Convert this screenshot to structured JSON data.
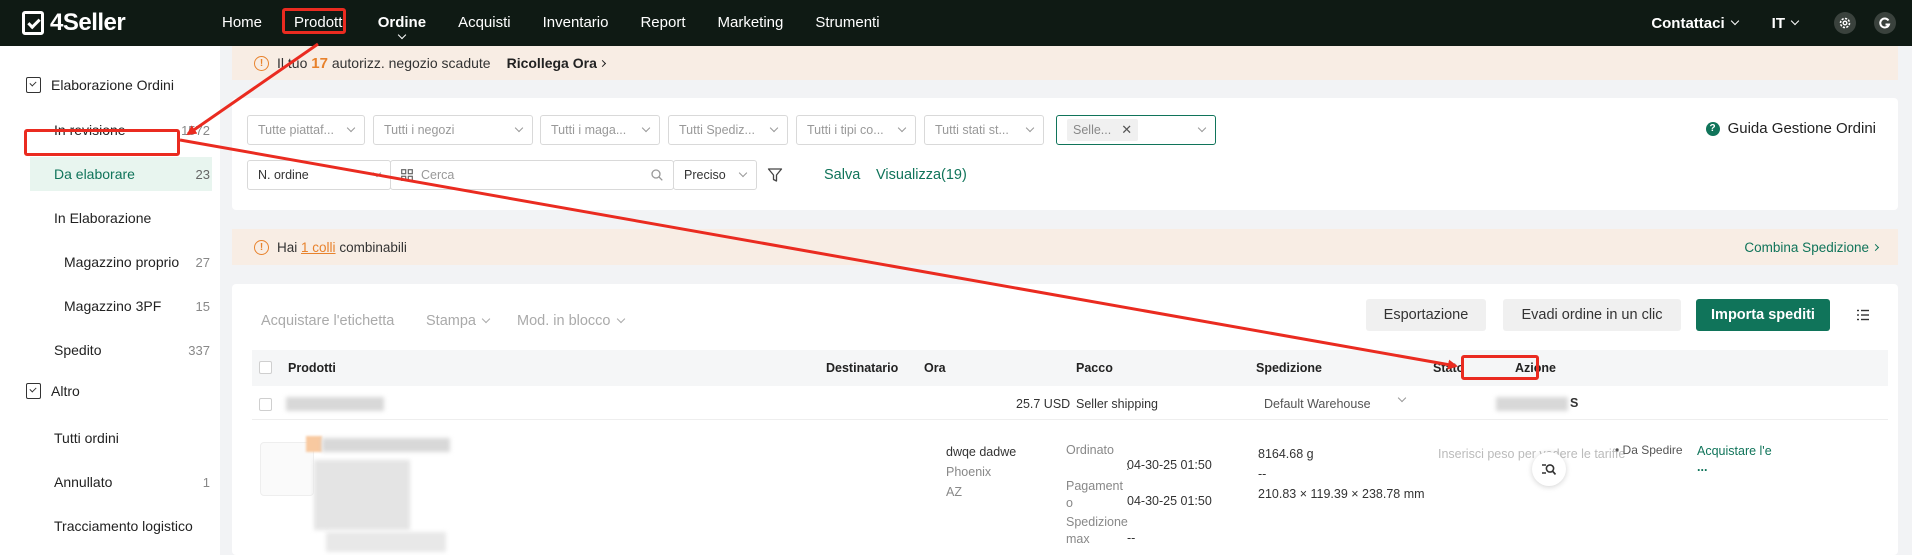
{
  "app": {
    "logo": "4Seller"
  },
  "topnav": {
    "items": [
      "Home",
      "Prodotti",
      "Ordine",
      "Acquisti",
      "Inventario",
      "Report",
      "Marketing",
      "Strumenti"
    ],
    "right": {
      "contact": "Contattaci",
      "language": "IT"
    }
  },
  "sidebar": {
    "group1": "Elaborazione Ordini",
    "items1": [
      {
        "label": "In revisione",
        "count": "1572"
      },
      {
        "label": "Da elaborare",
        "count": "23"
      },
      {
        "label": "In Elaborazione",
        "count": ""
      },
      {
        "label": "Magazzino proprio",
        "count": "27"
      },
      {
        "label": "Magazzino 3PF",
        "count": "15"
      },
      {
        "label": "Spedito",
        "count": "337"
      }
    ],
    "group2": "Altro",
    "items2": [
      {
        "label": "Tutti ordini",
        "count": ""
      },
      {
        "label": "Annullato",
        "count": "1"
      },
      {
        "label": "Tracciamento logistico",
        "count": ""
      }
    ]
  },
  "warning": {
    "prefix": "Il tuo",
    "count": "17",
    "suffix": "autorizz. negozio scadute",
    "link": "Ricollega Ora"
  },
  "filters": {
    "selects": [
      "Tutte piattaf...",
      "Tutti i negozi",
      "Tutti i maga...",
      "Tutti Spediz...",
      "Tutti i tipi co...",
      "Tutti stati st..."
    ],
    "tag": "Selle...",
    "help": "Guida Gestione Ordini",
    "order_field": "N. ordine",
    "search_placeholder": "Cerca",
    "match": "Preciso",
    "save": "Salva",
    "view": "Visualizza(19)"
  },
  "combine": {
    "prefix": "Hai",
    "link": "1 colli",
    "suffix": "combinabili",
    "action": "Combina Spedizione"
  },
  "toolbar": {
    "buy_label": "Acquistare l'etichetta",
    "print": "Stampa",
    "bulk": "Mod. in blocco",
    "export": "Esportazione",
    "one_click": "Evadi ordine in un clic",
    "import": "Importa spediti"
  },
  "table": {
    "headers": [
      "Prodotti",
      "Destinatario",
      "Ora",
      "Pacco",
      "Spedizione",
      "Stato",
      "Azione"
    ],
    "group_row": {
      "amount": "25.7 USD",
      "shipping": "Seller shipping",
      "warehouse": "Default Warehouse",
      "tail": "S"
    },
    "order": {
      "recipient_name": "dwqe dadwe",
      "city": "Phoenix",
      "state": "AZ",
      "ordered_label": "Ordinato",
      "ordered_time": "04-30-25 01:50",
      "payment_label": "Pagamento",
      "payment_time": "04-30-25 01:50",
      "shipmax_label": "Spedizione max",
      "shipmax_time": "--",
      "weight": "8164.68 g",
      "dash": "--",
      "dimensions": "210.83 × 119.39 × 238.78 mm",
      "shipping_hint": "Inserisci peso per vedere le tariffe",
      "status": "Da Spedire",
      "action": "Acquistare l'e",
      "more": "..."
    }
  },
  "colors": {
    "brand_green": "#10745a",
    "topbar": "#0f1a14",
    "warning_orange": "#e8822c",
    "annotation_red": "#ea2b20"
  }
}
